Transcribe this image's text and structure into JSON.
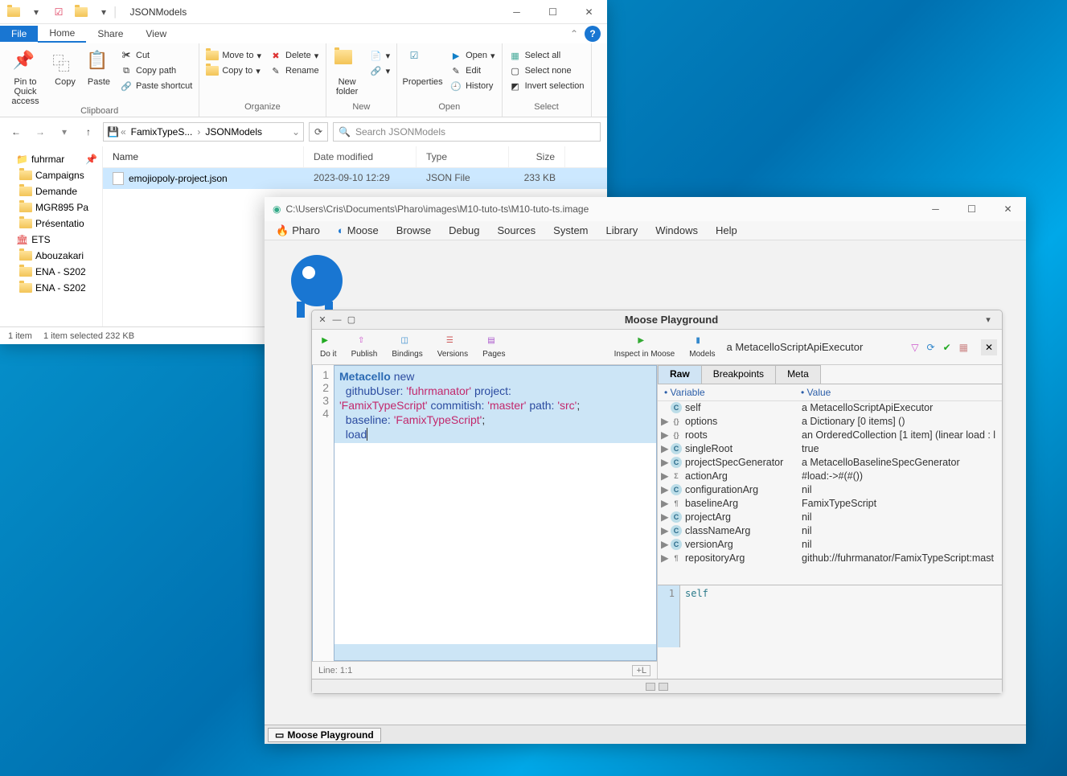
{
  "explorer": {
    "title": "JSONModels",
    "tabs": {
      "file": "File",
      "home": "Home",
      "share": "Share",
      "view": "View"
    },
    "ribbon": {
      "clipboard": {
        "label": "Clipboard",
        "pin": "Pin to Quick access",
        "copy": "Copy",
        "paste": "Paste",
        "cut": "Cut",
        "copypath": "Copy path",
        "pasteshort": "Paste shortcut"
      },
      "organize": {
        "label": "Organize",
        "moveto": "Move to",
        "copyto": "Copy to",
        "delete": "Delete",
        "rename": "Rename"
      },
      "new": {
        "label": "New",
        "newfolder": "New folder"
      },
      "open": {
        "label": "Open",
        "properties": "Properties",
        "open": "Open",
        "edit": "Edit",
        "history": "History"
      },
      "select": {
        "label": "Select",
        "selectall": "Select all",
        "selectnone": "Select none",
        "invert": "Invert selection"
      }
    },
    "breadcrumb": {
      "p1": "FamixTypeS...",
      "p2": "JSONModels"
    },
    "search_placeholder": "Search JSONModels",
    "columns": {
      "name": "Name",
      "date": "Date modified",
      "type": "Type",
      "size": "Size"
    },
    "sidebar": [
      "fuhrmar",
      "Campaigns",
      "Demande",
      "MGR895 Pa",
      "Présentatio",
      "ETS",
      "Abouzakari",
      "ENA - S202",
      "ENA - S202"
    ],
    "row": {
      "name": "emojiopoly-project.json",
      "date": "2023-09-10 12:29",
      "type": "JSON File",
      "size": "233 KB"
    },
    "status": {
      "items": "1 item",
      "selected": "1 item selected  232 KB"
    }
  },
  "pharo": {
    "titlepath": "C:\\Users\\Cris\\Documents\\Pharo\\images\\M10-tuto-ts\\M10-tuto-ts.image",
    "menu": [
      "Pharo",
      "Moose",
      "Browse",
      "Debug",
      "Sources",
      "System",
      "Library",
      "Windows",
      "Help"
    ],
    "playground": {
      "title": "Moose Playground",
      "toolbar": {
        "doit": "Do it",
        "publish": "Publish",
        "bindings": "Bindings",
        "versions": "Versions",
        "pages": "Pages",
        "inspect": "Inspect in Moose",
        "models": "Models"
      },
      "inspector_label": "a MetacelloScriptApiExecutor",
      "status": {
        "line": "Line: 1:1",
        "addline": "+L"
      },
      "tabs": {
        "raw": "Raw",
        "breakpoints": "Breakpoints",
        "meta": "Meta"
      },
      "varhdr": {
        "var": "• Variable",
        "val": "• Value"
      },
      "vars": [
        {
          "disc": "",
          "tag": "C",
          "name": "self",
          "val": "a MetacelloScriptApiExecutor"
        },
        {
          "disc": "▶",
          "tag": "{}",
          "name": "options",
          "val": "a Dictionary [0 items] ()"
        },
        {
          "disc": "▶",
          "tag": "{}",
          "name": "roots",
          "val": "an OrderedCollection [1 item] (linear load :  l"
        },
        {
          "disc": "▶",
          "tag": "C",
          "name": "singleRoot",
          "val": "true"
        },
        {
          "disc": "▶",
          "tag": "C",
          "name": "projectSpecGenerator",
          "val": "a MetacelloBaselineSpecGenerator"
        },
        {
          "disc": "▶",
          "tag": "Σ",
          "name": "actionArg",
          "val": "#load:->#(#())"
        },
        {
          "disc": "▶",
          "tag": "C",
          "name": "configurationArg",
          "val": "nil"
        },
        {
          "disc": "▶",
          "tag": "¶",
          "name": "baselineArg",
          "val": "FamixTypeScript"
        },
        {
          "disc": "▶",
          "tag": "C",
          "name": "projectArg",
          "val": "nil"
        },
        {
          "disc": "▶",
          "tag": "C",
          "name": "classNameArg",
          "val": "nil"
        },
        {
          "disc": "▶",
          "tag": "C",
          "name": "versionArg",
          "val": "nil"
        },
        {
          "disc": "▶",
          "tag": "¶",
          "name": "repositoryArg",
          "val": "github://fuhrmanator/FamixTypeScript:mast"
        }
      ],
      "self": "self"
    },
    "taskbar": "Moose Playground"
  }
}
